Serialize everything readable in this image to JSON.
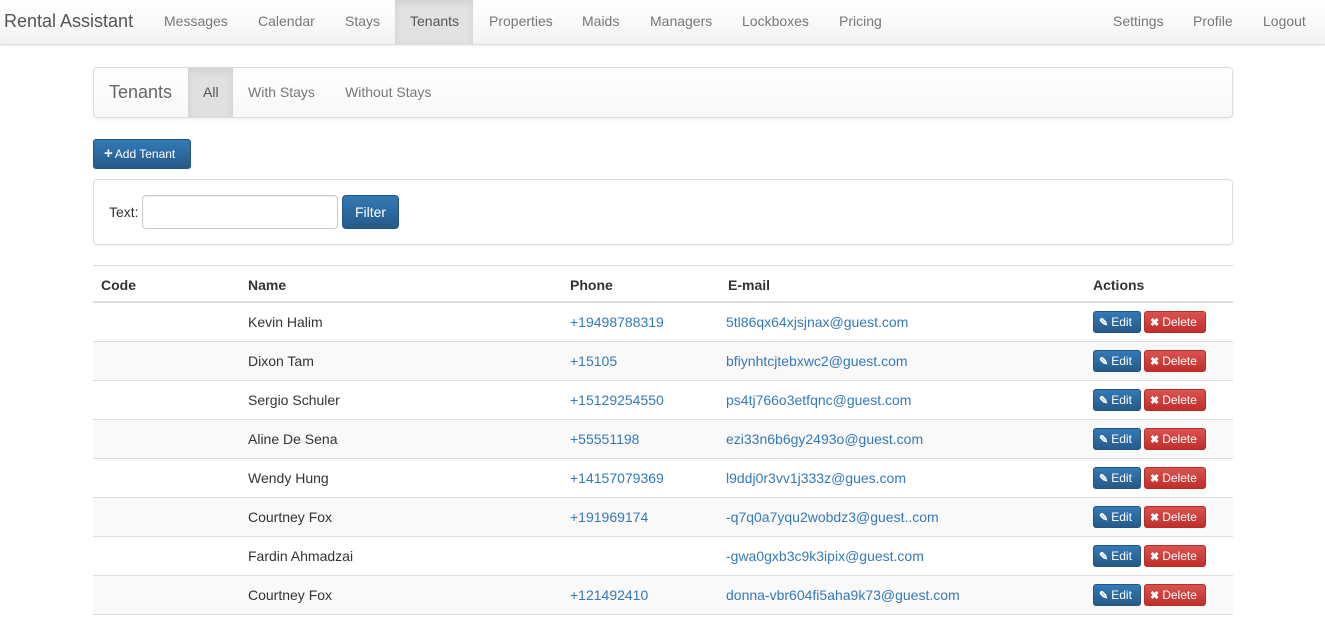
{
  "navbar": {
    "brand": "Rental Assistant",
    "items": [
      {
        "label": "Messages"
      },
      {
        "label": "Calendar"
      },
      {
        "label": "Stays"
      },
      {
        "label": "Tenants"
      },
      {
        "label": "Properties"
      },
      {
        "label": "Maids"
      },
      {
        "label": "Managers"
      },
      {
        "label": "Lockboxes"
      },
      {
        "label": "Pricing"
      }
    ],
    "right_items": [
      {
        "label": "Settings"
      },
      {
        "label": "Profile"
      },
      {
        "label": "Logout"
      }
    ],
    "active": "Tenants"
  },
  "subnav": {
    "title": "Tenants",
    "tabs": [
      {
        "label": "All"
      },
      {
        "label": "With Stays"
      },
      {
        "label": "Without Stays"
      }
    ],
    "active": "All"
  },
  "add_button": {
    "icon": "plus-icon",
    "label": "Add Tenant"
  },
  "filter": {
    "label": "Text:",
    "value": "",
    "placeholder": "",
    "button": "Filter"
  },
  "table": {
    "headers": {
      "code": "Code",
      "name": "Name",
      "phone": "Phone",
      "email": "E-mail",
      "actions": "Actions"
    },
    "edit_label": "Edit",
    "delete_label": "Delete",
    "rows": [
      {
        "code": "",
        "name": "Kevin Halim",
        "phone": "+19498788319",
        "email": "5tl86qx64xjsjnax@guest.com"
      },
      {
        "code": "",
        "name": "Dixon Tam",
        "phone": "+15105",
        "email": "bfiynhtcjtebxwc2@guest.com"
      },
      {
        "code": "",
        "name": "Sergio Schuler",
        "phone": "+15129254550",
        "email": "ps4tj766o3etfqnc@guest.com"
      },
      {
        "code": "",
        "name": "Aline De Sena",
        "phone": "+55551198",
        "email": "ezi33n6b6gy2493o@guest.com"
      },
      {
        "code": "",
        "name": "Wendy Hung",
        "phone": "+14157079369",
        "email": "l9ddj0r3vv1j333z@gues.com"
      },
      {
        "code": "",
        "name": "Courtney Fox",
        "phone": "+191969174",
        "email": "-q7q0a7yqu2wobdz3@guest..com"
      },
      {
        "code": "",
        "name": "Fardin Ahmadzai",
        "phone": "",
        "email": "-gwa0gxb3c9k3ipix@guest.com"
      },
      {
        "code": "",
        "name": "Courtney Fox",
        "phone": "+121492410",
        "email": "donna-vbr604fi5aha9k73@guest.com"
      }
    ]
  },
  "colors": {
    "primary": "#337ab7",
    "danger": "#d9534f",
    "link": "#337ab7"
  }
}
